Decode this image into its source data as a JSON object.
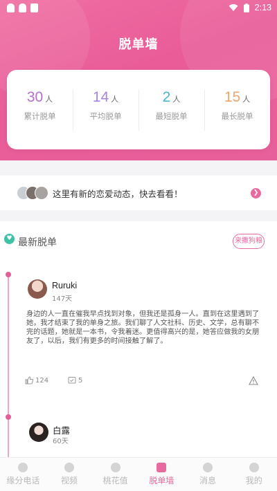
{
  "status_bar": {
    "time": "2:13"
  },
  "header": {
    "title": "脱单墙"
  },
  "stats": [
    {
      "value": "30",
      "unit": "人",
      "label": "累计脱单",
      "color": "#b56fcf"
    },
    {
      "value": "14",
      "unit": "人",
      "label": "平均脱单",
      "color": "#a784e0"
    },
    {
      "value": "2",
      "unit": "人",
      "label": "最短脱单",
      "color": "#4bb6c9"
    },
    {
      "value": "15",
      "unit": "人",
      "label": "最长脱单",
      "color": "#f0a56e"
    }
  ],
  "notice": {
    "text": "这里有新的恋爱动态，快去看看！"
  },
  "section": {
    "title": "最新脱单",
    "button": "来撒狗粮"
  },
  "posts": [
    {
      "name": "Ruruki",
      "days": "147天",
      "body": "身边的人一直在催我早点找到对象，但我还是孤身一人。直到在这里遇到了她，我才结束了我的单身之旅。我们聊了人文社科、历史、文学，总有聊不完的话题，她就是一本书，令我着迷。更值得高兴的是，她答应做我的女朋友了，以后，我们有更多的时间接触了解了。",
      "likes": "124",
      "comments": "5"
    },
    {
      "name": "白露",
      "days": "60天"
    }
  ],
  "tabs": [
    {
      "label": "缘分电话"
    },
    {
      "label": "视频"
    },
    {
      "label": "桃花值"
    },
    {
      "label": "脱单墙"
    },
    {
      "label": "消息"
    },
    {
      "label": "我的"
    }
  ],
  "accent": "#e86b9f"
}
